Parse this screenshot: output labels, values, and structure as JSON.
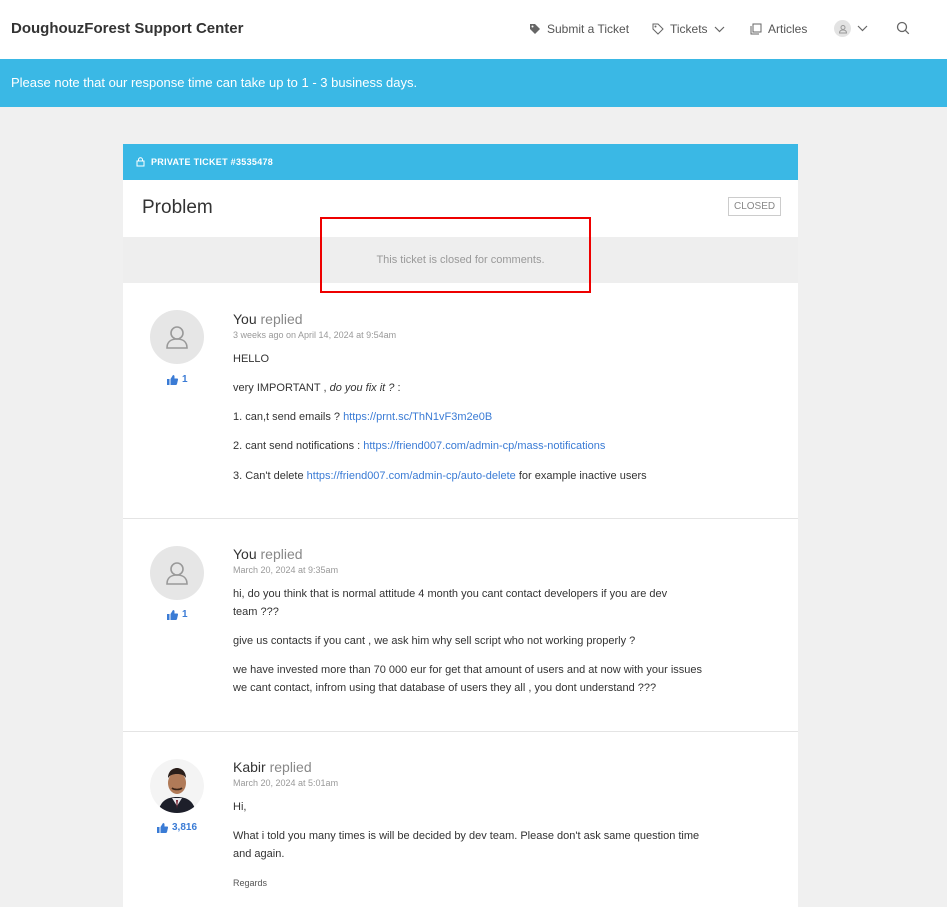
{
  "header": {
    "brand": "DoughouzForest Support Center",
    "nav": {
      "submit_ticket": "Submit a Ticket",
      "tickets": "Tickets",
      "articles": "Articles"
    }
  },
  "notice": "Please note that our response time can take up to 1 - 3 business days.",
  "ticket": {
    "label": "PRIVATE TICKET #3535478",
    "title": "Problem",
    "status": "CLOSED",
    "closed_message": "This ticket is closed for comments."
  },
  "replies": [
    {
      "author": "You",
      "verb": "replied",
      "time": "3 weeks ago on April 14, 2024 at 9:54am",
      "likes": "1",
      "lines": {
        "l1": "HELLO",
        "l2a": "very IMPORTANT   , ",
        "l2b": "do you fix it ?",
        "l2c": "  :",
        "l3a": "1.  can,t send emails ? ",
        "l3link": "https://prnt.sc/ThN1vF3m2e0B",
        "l4a": "2. cant send notifications : ",
        "l4link": "https://friend007.com/admin-cp/mass-notifications",
        "l5a": "3.  Can't delete ",
        "l5link": "https://friend007.com/admin-cp/auto-delete",
        "l5b": " for example inactive users"
      }
    },
    {
      "author": "You",
      "verb": "replied",
      "time": "March 20, 2024 at 9:35am",
      "likes": "1",
      "lines": {
        "l1": "hi, do you think that is normal attitude 4 month you cant contact developers if you are dev team ???",
        "l2": "give us contacts if you cant , we ask him why sell script who not working properly ?",
        "l3": "we have invested more than 70 000 eur for get that amount of users and at now with your issues we cant contact, infrom  using that database of users they all , you dont understand ???"
      }
    },
    {
      "author": "Kabir",
      "verb": "replied",
      "time": "March 20, 2024 at 5:01am",
      "likes": "3,816",
      "lines": {
        "l1": "Hi,",
        "l2": "What i told you many times is will be decided by dev team. Please don't ask same question time and again.",
        "l3": "Regards"
      }
    }
  ]
}
